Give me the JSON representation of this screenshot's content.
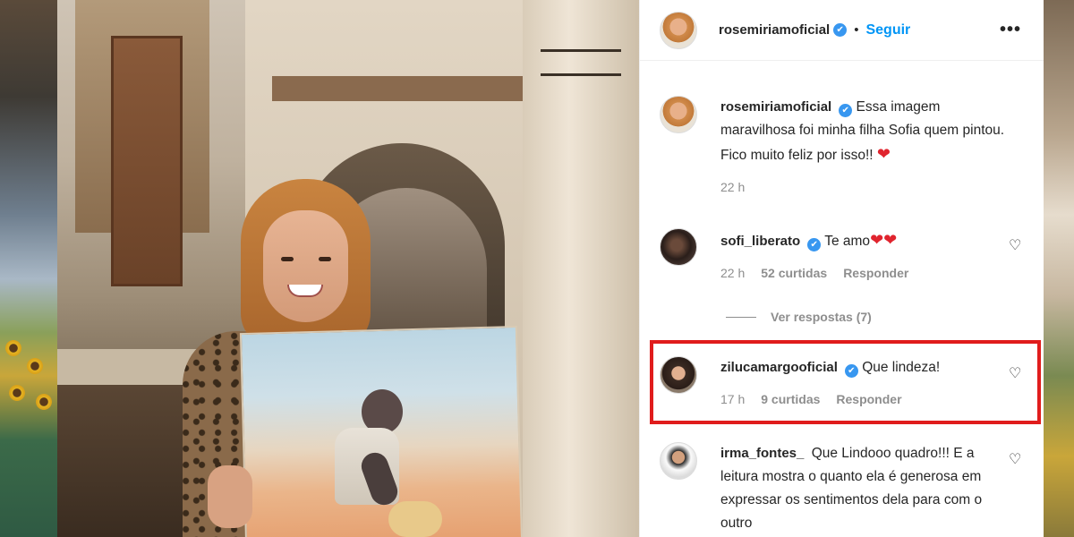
{
  "post": {
    "author": "rosemiriamoficial",
    "verified_glyph": "✔",
    "separator": "•",
    "follow_label": "Seguir",
    "more_glyph": "•••"
  },
  "comments": [
    {
      "username": "rosemiriamoficial",
      "verified": true,
      "text": "Essa imagem maravilhosa foi minha filha Sofia quem pintou. Fico muito feliz por isso!!",
      "emoji": "❤",
      "time": "22 h",
      "likes": "",
      "reply_label": ""
    },
    {
      "username": "sofi_liberato",
      "verified": true,
      "text": "Te amo",
      "emoji": "❤❤",
      "time": "22 h",
      "likes": "52 curtidas",
      "reply_label": "Responder"
    },
    {
      "username": "zilucamargooficial",
      "verified": true,
      "text": "Que lindeza!",
      "emoji": "",
      "time": "17 h",
      "likes": "9 curtidas",
      "reply_label": "Responder"
    },
    {
      "username": "irma_fontes_",
      "verified": false,
      "text": "Que Lindooo quadro!!! E a leitura mostra o quanto ela é generosa em expressar os sentimentos dela para com o outro",
      "emoji": "",
      "time": "",
      "likes": "",
      "reply_label": ""
    }
  ],
  "view_replies_label": "Ver respostas (7)",
  "icons": {
    "like": "♡",
    "verified": "check-badge"
  },
  "colors": {
    "follow_blue": "#0095f6",
    "verified_blue": "#3897f0",
    "highlight_red": "#e01c1c"
  }
}
